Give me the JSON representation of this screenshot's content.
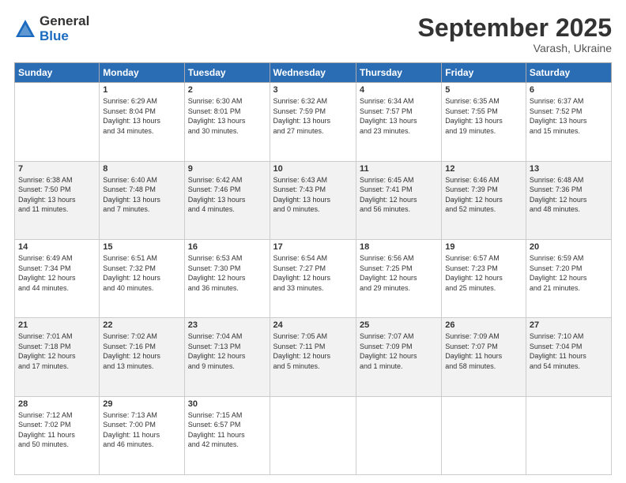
{
  "logo": {
    "general": "General",
    "blue": "Blue"
  },
  "title": "September 2025",
  "location": "Varash, Ukraine",
  "weekdays": [
    "Sunday",
    "Monday",
    "Tuesday",
    "Wednesday",
    "Thursday",
    "Friday",
    "Saturday"
  ],
  "weeks": [
    [
      {
        "day": "",
        "info": ""
      },
      {
        "day": "1",
        "info": "Sunrise: 6:29 AM\nSunset: 8:04 PM\nDaylight: 13 hours\nand 34 minutes."
      },
      {
        "day": "2",
        "info": "Sunrise: 6:30 AM\nSunset: 8:01 PM\nDaylight: 13 hours\nand 30 minutes."
      },
      {
        "day": "3",
        "info": "Sunrise: 6:32 AM\nSunset: 7:59 PM\nDaylight: 13 hours\nand 27 minutes."
      },
      {
        "day": "4",
        "info": "Sunrise: 6:34 AM\nSunset: 7:57 PM\nDaylight: 13 hours\nand 23 minutes."
      },
      {
        "day": "5",
        "info": "Sunrise: 6:35 AM\nSunset: 7:55 PM\nDaylight: 13 hours\nand 19 minutes."
      },
      {
        "day": "6",
        "info": "Sunrise: 6:37 AM\nSunset: 7:52 PM\nDaylight: 13 hours\nand 15 minutes."
      }
    ],
    [
      {
        "day": "7",
        "info": "Sunrise: 6:38 AM\nSunset: 7:50 PM\nDaylight: 13 hours\nand 11 minutes."
      },
      {
        "day": "8",
        "info": "Sunrise: 6:40 AM\nSunset: 7:48 PM\nDaylight: 13 hours\nand 7 minutes."
      },
      {
        "day": "9",
        "info": "Sunrise: 6:42 AM\nSunset: 7:46 PM\nDaylight: 13 hours\nand 4 minutes."
      },
      {
        "day": "10",
        "info": "Sunrise: 6:43 AM\nSunset: 7:43 PM\nDaylight: 13 hours\nand 0 minutes."
      },
      {
        "day": "11",
        "info": "Sunrise: 6:45 AM\nSunset: 7:41 PM\nDaylight: 12 hours\nand 56 minutes."
      },
      {
        "day": "12",
        "info": "Sunrise: 6:46 AM\nSunset: 7:39 PM\nDaylight: 12 hours\nand 52 minutes."
      },
      {
        "day": "13",
        "info": "Sunrise: 6:48 AM\nSunset: 7:36 PM\nDaylight: 12 hours\nand 48 minutes."
      }
    ],
    [
      {
        "day": "14",
        "info": "Sunrise: 6:49 AM\nSunset: 7:34 PM\nDaylight: 12 hours\nand 44 minutes."
      },
      {
        "day": "15",
        "info": "Sunrise: 6:51 AM\nSunset: 7:32 PM\nDaylight: 12 hours\nand 40 minutes."
      },
      {
        "day": "16",
        "info": "Sunrise: 6:53 AM\nSunset: 7:30 PM\nDaylight: 12 hours\nand 36 minutes."
      },
      {
        "day": "17",
        "info": "Sunrise: 6:54 AM\nSunset: 7:27 PM\nDaylight: 12 hours\nand 33 minutes."
      },
      {
        "day": "18",
        "info": "Sunrise: 6:56 AM\nSunset: 7:25 PM\nDaylight: 12 hours\nand 29 minutes."
      },
      {
        "day": "19",
        "info": "Sunrise: 6:57 AM\nSunset: 7:23 PM\nDaylight: 12 hours\nand 25 minutes."
      },
      {
        "day": "20",
        "info": "Sunrise: 6:59 AM\nSunset: 7:20 PM\nDaylight: 12 hours\nand 21 minutes."
      }
    ],
    [
      {
        "day": "21",
        "info": "Sunrise: 7:01 AM\nSunset: 7:18 PM\nDaylight: 12 hours\nand 17 minutes."
      },
      {
        "day": "22",
        "info": "Sunrise: 7:02 AM\nSunset: 7:16 PM\nDaylight: 12 hours\nand 13 minutes."
      },
      {
        "day": "23",
        "info": "Sunrise: 7:04 AM\nSunset: 7:13 PM\nDaylight: 12 hours\nand 9 minutes."
      },
      {
        "day": "24",
        "info": "Sunrise: 7:05 AM\nSunset: 7:11 PM\nDaylight: 12 hours\nand 5 minutes."
      },
      {
        "day": "25",
        "info": "Sunrise: 7:07 AM\nSunset: 7:09 PM\nDaylight: 12 hours\nand 1 minute."
      },
      {
        "day": "26",
        "info": "Sunrise: 7:09 AM\nSunset: 7:07 PM\nDaylight: 11 hours\nand 58 minutes."
      },
      {
        "day": "27",
        "info": "Sunrise: 7:10 AM\nSunset: 7:04 PM\nDaylight: 11 hours\nand 54 minutes."
      }
    ],
    [
      {
        "day": "28",
        "info": "Sunrise: 7:12 AM\nSunset: 7:02 PM\nDaylight: 11 hours\nand 50 minutes."
      },
      {
        "day": "29",
        "info": "Sunrise: 7:13 AM\nSunset: 7:00 PM\nDaylight: 11 hours\nand 46 minutes."
      },
      {
        "day": "30",
        "info": "Sunrise: 7:15 AM\nSunset: 6:57 PM\nDaylight: 11 hours\nand 42 minutes."
      },
      {
        "day": "",
        "info": ""
      },
      {
        "day": "",
        "info": ""
      },
      {
        "day": "",
        "info": ""
      },
      {
        "day": "",
        "info": ""
      }
    ]
  ]
}
